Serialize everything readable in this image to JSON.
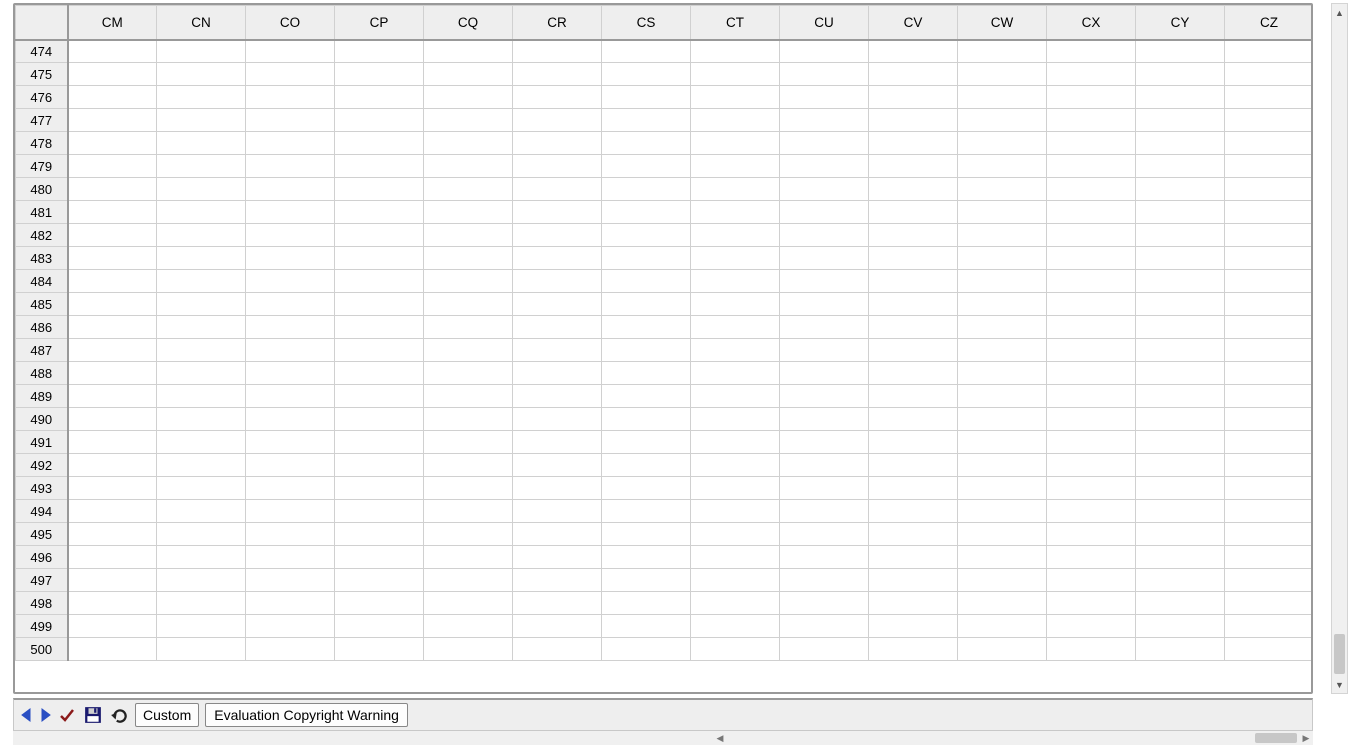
{
  "columns": [
    "CM",
    "CN",
    "CO",
    "CP",
    "CQ",
    "CR",
    "CS",
    "CT",
    "CU",
    "CV",
    "CW",
    "CX",
    "CY",
    "CZ"
  ],
  "rows": [
    "474",
    "475",
    "476",
    "477",
    "478",
    "479",
    "480",
    "481",
    "482",
    "483",
    "484",
    "485",
    "486",
    "487",
    "488",
    "489",
    "490",
    "491",
    "492",
    "493",
    "494",
    "495",
    "496",
    "497",
    "498",
    "499",
    "500"
  ],
  "toolbar": {
    "custom_label": "Custom",
    "warning_label": "Evaluation Copyright Warning"
  }
}
